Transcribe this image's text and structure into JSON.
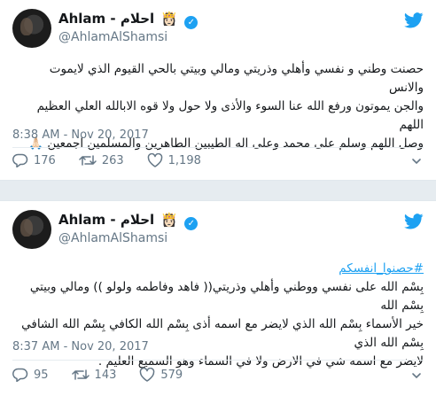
{
  "tweets": [
    {
      "author_name": "Ahlam - احلام",
      "author_emoji": "👸🏻",
      "handle": "@AhlamAlShamsi",
      "text_lines": [
        "حصنت وطني و نفسي وأهلي وذريتي ومالي وبيتي بالحي القيوم الذي لايموت والانس",
        "والجن يموتون ورفع الله عنا السوء والأذى ولا حول ولا قوه الابالله العلي العظيم اللهم",
        "وصل اللهم وسلم على محمد وعلى اله الطيبين الطاهرين والمسلمين اجمعين 🙏🏻"
      ],
      "timestamp": "8:38 AM - Nov 20, 2017",
      "replies": "176",
      "retweets": "263",
      "likes": "1,198"
    },
    {
      "author_name": "Ahlam - احلام",
      "author_emoji": "👸🏻",
      "handle": "@AhlamAlShamsi",
      "hashtag": "#حصنوا_انفسكم",
      "text_lines": [
        "بِسْم الله على نفسي ووطني وأهلي وذريتي(( فاهد وفاطمه ولولو )) ومالي وبيتي بِسْم الله",
        "خير الأسماء بِسْم الله الذي لايضر مع اسمه أذى بِسْم الله الكافي بِسْم الله الشافي بِسْم الله الذي",
        "لايضر مع اسمه شي في الارض ولا في السماء وهو السميع العليم ."
      ],
      "timestamp": "8:37 AM - Nov 20, 2017",
      "replies": "95",
      "retweets": "143",
      "likes": "579"
    }
  ],
  "icons": {
    "brand": "twitter-bird-icon",
    "verified": "verified-badge-icon",
    "reply": "reply-icon",
    "retweet": "retweet-icon",
    "like": "heart-icon",
    "more": "chevron-down-icon"
  },
  "colors": {
    "brand_blue": "#1da1f2",
    "text": "#14171a",
    "secondary_text": "#657786",
    "separator": "#e6ecf0"
  }
}
